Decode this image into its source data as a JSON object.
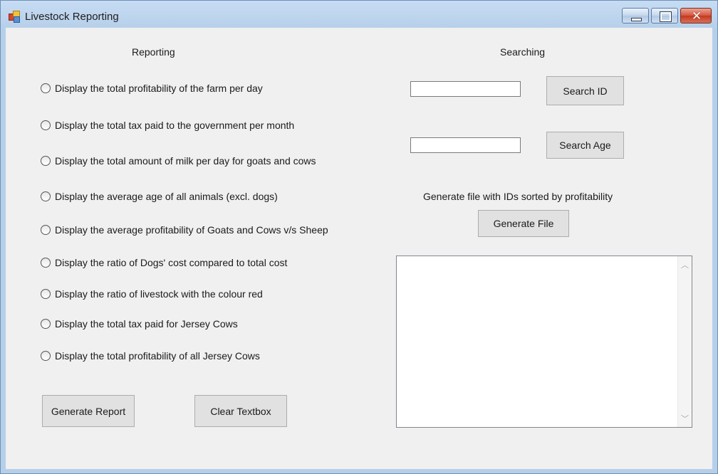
{
  "window": {
    "title": "Livestock Reporting"
  },
  "reporting": {
    "heading": "Reporting",
    "options": [
      "Display the total profitability of the farm per day",
      "Display the total tax paid to the government per month",
      "Display the total amount of milk per day for goats and cows",
      "Display the average age of all animals (excl. dogs)",
      "Display the average profitability of Goats and Cows v/s Sheep",
      "Display the ratio of Dogs' cost compared to total cost",
      "Display the ratio of livestock with the colour red",
      "Display the total tax paid for Jersey Cows",
      "Display the total profitability of all Jersey Cows"
    ],
    "generate_report_label": "Generate Report",
    "clear_textbox_label": "Clear Textbox"
  },
  "searching": {
    "heading": "Searching",
    "id_input_value": "",
    "age_input_value": "",
    "search_id_label": "Search ID",
    "search_age_label": "Search Age",
    "generate_file_caption": "Generate file with IDs sorted by profitability",
    "generate_file_label": "Generate File"
  },
  "output": {
    "text": ""
  }
}
